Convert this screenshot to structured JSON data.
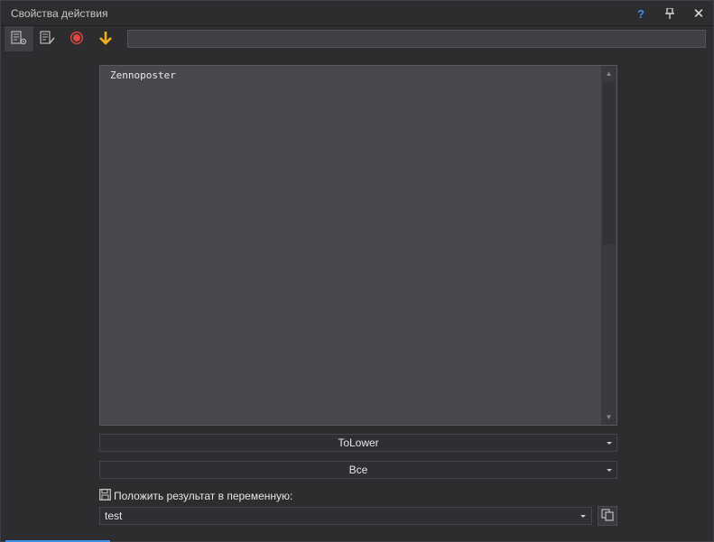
{
  "window": {
    "title": "Свойства действия",
    "help_glyph": "?",
    "close_glyph": "✕"
  },
  "toolbar": {
    "buttons": [
      {
        "icon": "properties-settings-icon",
        "active": true
      },
      {
        "icon": "properties-edit-icon",
        "active": false
      },
      {
        "icon": "record-icon",
        "color": "#e0473f",
        "active": false
      },
      {
        "icon": "down-arrow-icon",
        "color": "#f0b020",
        "active": false
      }
    ],
    "search_value": ""
  },
  "editor": {
    "text": "Zennoposter"
  },
  "dropdowns": {
    "operation": "ToLower",
    "scope": "Все"
  },
  "result": {
    "label": "Положить результат в переменную:",
    "variable": "test"
  },
  "colors": {
    "accent": "#3c8fe6",
    "background": "#2d2d30",
    "record": "#e0473f",
    "arrow": "#f0b020"
  }
}
